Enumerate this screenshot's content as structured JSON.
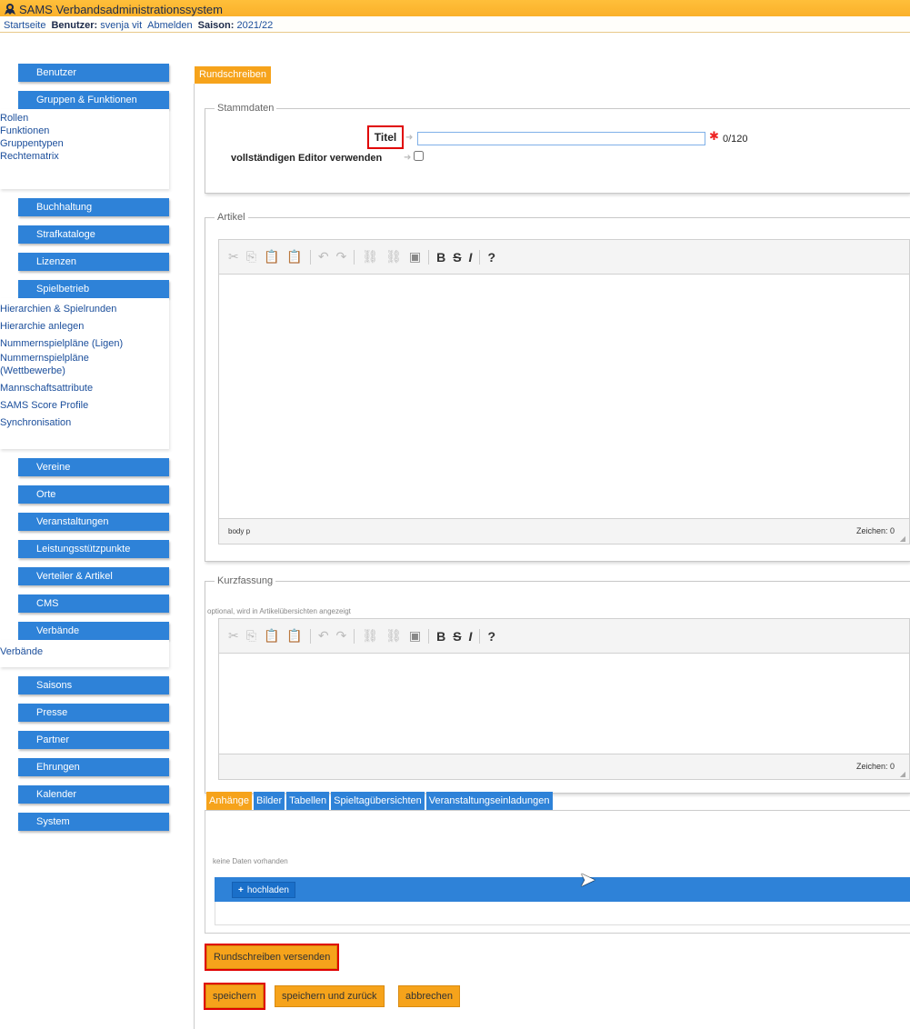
{
  "app": {
    "title": "SAMS Verbandsadministrationssystem"
  },
  "topnav": {
    "home": "Startseite",
    "user_label": "Benutzer:",
    "user_value": "svenja vit",
    "logout": "Abmelden",
    "season_label": "Saison:",
    "season_value": "2021/22"
  },
  "sidebar": {
    "benutzer": "Benutzer",
    "gruppen": "Gruppen & Funktionen",
    "gruppen_items": [
      "Rollen",
      "Funktionen",
      "Gruppentypen",
      "Rechtematrix"
    ],
    "buchhaltung": "Buchhaltung",
    "strafkataloge": "Strafkataloge",
    "lizenzen": "Lizenzen",
    "spielbetrieb": "Spielbetrieb",
    "spielbetrieb_items": [
      "Hierarchien & Spielrunden",
      "Hierarchie anlegen",
      "Nummernspielpläne (Ligen)",
      "Nummernspielpläne",
      "(Wettbewerbe)",
      "Mannschaftsattribute",
      "SAMS Score Profile",
      "Synchronisation"
    ],
    "vereine": "Vereine",
    "orte": "Orte",
    "veranstaltungen": "Veranstaltungen",
    "leistungs": "Leistungsstützpunkte",
    "verteiler": "Verteiler & Artikel",
    "cms": "CMS",
    "verbaende": "Verbände",
    "verbaende_items": [
      "Verbände"
    ],
    "saisons": "Saisons",
    "presse": "Presse",
    "partner": "Partner",
    "ehrungen": "Ehrungen",
    "kalender": "Kalender",
    "system": "System"
  },
  "main": {
    "tab": "Rundschreiben",
    "stammdaten": {
      "legend": "Stammdaten",
      "titel_label": "Titel",
      "titel_value": "",
      "counter": "0/120",
      "editor_label": "vollständigen Editor verwenden"
    },
    "artikel": {
      "legend": "Artikel",
      "path": "body  p",
      "chars": "Zeichen: 0"
    },
    "kurzfassung": {
      "legend": "Kurzfassung",
      "hint": "optional, wird in Artikelübersichten angezeigt",
      "chars": "Zeichen: 0"
    },
    "tabs": [
      "Anhänge",
      "Bilder",
      "Tabellen",
      "Spieltagübersichten",
      "Veranstaltungseinladungen"
    ],
    "attachments": {
      "empty": "keine Daten vorhanden",
      "upload": "hochladen"
    },
    "buttons": {
      "send": "Rundschreiben versenden",
      "save": "speichern",
      "save_back": "speichern und zurück",
      "cancel": "abbrechen"
    }
  },
  "colors": {
    "orange": "#f6a31b",
    "blue": "#2e82d8",
    "highlight": "#e00000"
  }
}
